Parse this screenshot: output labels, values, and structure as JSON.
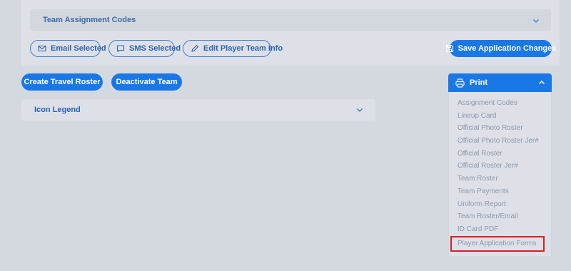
{
  "team_assignment_codes": {
    "label": "Team Assignment Codes"
  },
  "actions": {
    "email_selected": "Email Selected",
    "sms_selected": "SMS Selected",
    "edit_player_team_info": "Edit Player Team Info",
    "save_application_changes": "Save Application Changes"
  },
  "team_buttons": {
    "create_travel_roster": "Create Travel Roster",
    "deactivate_team": "Deactivate Team"
  },
  "icon_legend": {
    "label": "Icon Legend"
  },
  "print_menu": {
    "label": "Print",
    "items": [
      "Assignment Codes",
      "Lineup Card",
      "Official Photo Roster",
      "Official Photo Roster Jer#",
      "Official Roster",
      "Official Roster Jer#",
      "Team Roster",
      "Team Payments",
      "Uniform Report",
      "Team Roster/Email",
      "ID Card PDF",
      "Player Application Forms"
    ],
    "highlighted_item": "Player Application Forms"
  },
  "colors": {
    "primary": "#1a78e6",
    "background": "#d4d9e0",
    "panel": "#dde1e7",
    "highlight_border": "#d6202a"
  }
}
